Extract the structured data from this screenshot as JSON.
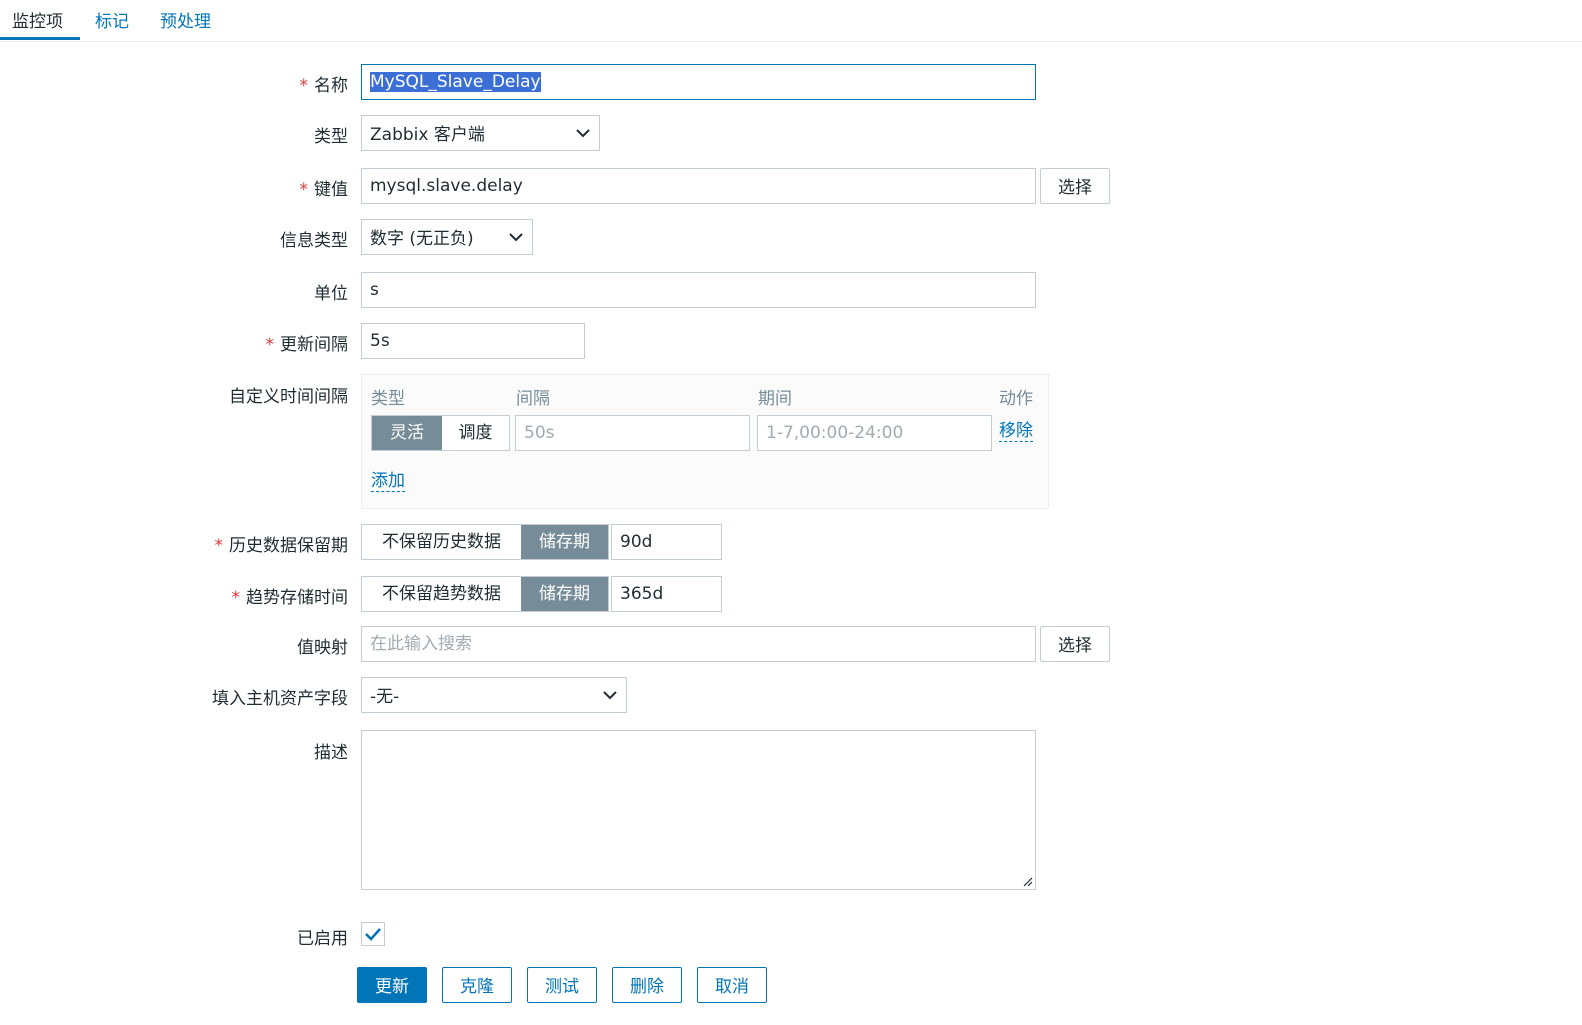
{
  "tabs": [
    {
      "label": "监控项"
    },
    {
      "label": "标记"
    },
    {
      "label": "预处理"
    }
  ],
  "form": {
    "name": {
      "label": "名称",
      "value": "MySQL_Slave_Delay"
    },
    "type": {
      "label": "类型",
      "value": "Zabbix 客户端"
    },
    "key": {
      "label": "键值",
      "value": "mysql.slave.delay",
      "button": "选择"
    },
    "info_type": {
      "label": "信息类型",
      "value": "数字 (无正负)"
    },
    "units": {
      "label": "单位",
      "value": "s"
    },
    "update_interval": {
      "label": "更新间隔",
      "value": "5s"
    },
    "custom_intervals": {
      "label": "自定义时间间隔",
      "headers": {
        "type": "类型",
        "interval": "间隔",
        "period": "期间",
        "action": "动作"
      },
      "row": {
        "flexible": "灵活",
        "scheduling": "调度",
        "interval_placeholder": "50s",
        "period_placeholder": "1-7,00:00-24:00",
        "remove": "移除"
      },
      "add": "添加"
    },
    "history": {
      "label": "历史数据保留期",
      "no_keep": "不保留历史数据",
      "storage": "储存期",
      "value": "90d"
    },
    "trends": {
      "label": "趋势存储时间",
      "no_keep": "不保留趋势数据",
      "storage": "储存期",
      "value": "365d"
    },
    "valuemap": {
      "label": "值映射",
      "placeholder": "在此输入搜索",
      "button": "选择"
    },
    "inventory": {
      "label": "填入主机资产字段",
      "value": "-无-"
    },
    "description": {
      "label": "描述",
      "value": ""
    },
    "enabled": {
      "label": "已启用",
      "checked": true
    }
  },
  "buttons": {
    "update": "更新",
    "clone": "克隆",
    "test": "测试",
    "delete": "删除",
    "cancel": "取消"
  },
  "colors": {
    "accent": "#0275b8",
    "segment_active": "#768d99",
    "required": "#e33734"
  }
}
